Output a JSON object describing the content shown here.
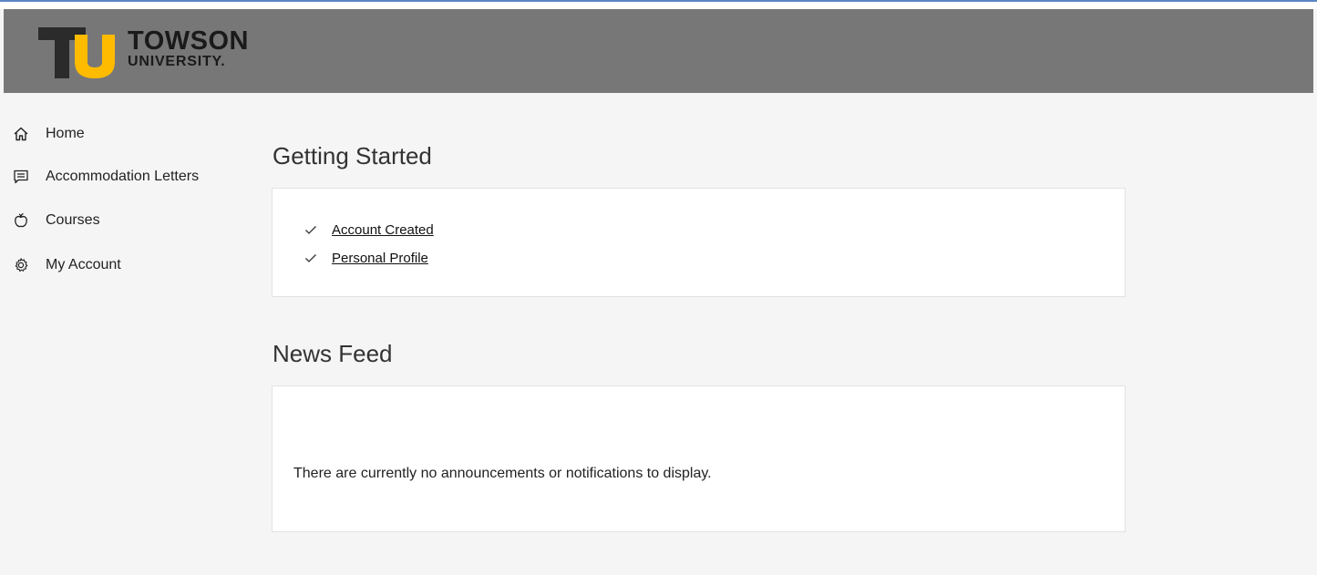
{
  "brand": {
    "logo_line1": "TOWSON",
    "logo_line2": "UNIVERSITY."
  },
  "colors": {
    "header_bg": "#777777",
    "logo_gold": "#ffbb00",
    "logo_dark": "#2b2b2b",
    "page_bg": "#f5f5f5",
    "card_bg": "#ffffff"
  },
  "sidebar": {
    "items": [
      {
        "label": "Home",
        "icon": "home-icon"
      },
      {
        "label": "Accommodation Letters",
        "icon": "message-icon"
      },
      {
        "label": "Courses",
        "icon": "apple-icon"
      },
      {
        "label": "My Account",
        "icon": "gear-icon"
      }
    ]
  },
  "getting_started": {
    "title": "Getting Started",
    "items": [
      {
        "label": "Account Created",
        "icon": "checkmark-icon"
      },
      {
        "label": "Personal Profile",
        "icon": "checkmark-icon"
      }
    ]
  },
  "news_feed": {
    "title": "News Feed",
    "empty_message": "There are currently no announcements or notifications to display."
  }
}
